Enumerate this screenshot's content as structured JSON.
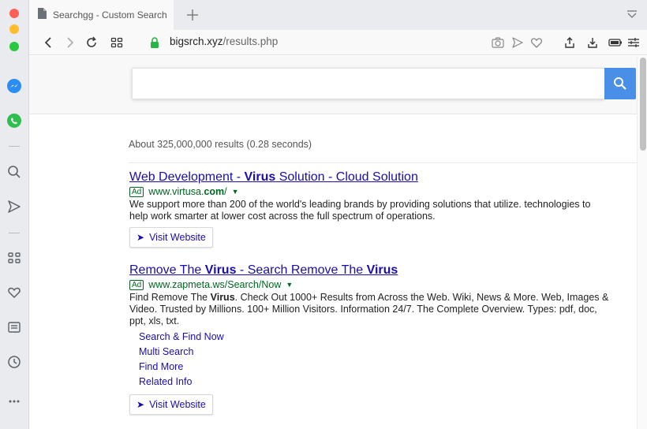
{
  "tab": {
    "title": "Searchgg - Custom Search"
  },
  "address": {
    "host": "bigsrch.xyz",
    "path": "/results.php"
  },
  "stats": "About 325,000,000 results (0.28 seconds)",
  "results": [
    {
      "title_pre": "Web Development - ",
      "title_bold": "Virus",
      "title_post": " Solution - Cloud Solution",
      "ad_label": "Ad",
      "url_pre": "www.virtusa.",
      "url_bold": "com",
      "url_post": "/",
      "desc": "We support more than 200 of the world's leading brands by providing solutions that utilize. technologies to help work smarter at lower cost across the full spectrum of operations.",
      "visit_label": "Visit Website"
    },
    {
      "title_pre": "Remove The ",
      "title_bold": "Virus",
      "title_mid": " - Search Remove The ",
      "title_bold2": "Virus",
      "ad_label": "Ad",
      "url": "www.zapmeta.ws/Search/Now",
      "desc_pre": "Find Remove The ",
      "desc_bold": "Virus",
      "desc_post": ". Check Out 1000+ Results from Across the Web. Wiki, News & More. Web, Images & Video. Trusted by Millions. 100+ Million Visitors. Information 24/7. The Complete Overview. Types: pdf, doc, ppt, xls, txt.",
      "sitelinks": [
        "Search & Find Now",
        "Multi Search",
        "Find More",
        "Related Info"
      ],
      "visit_label": "Visit Website"
    }
  ],
  "colors": {
    "link": "#1a0dab",
    "url_green": "#006621",
    "search_button": "#4a8fe7",
    "traffic_red": "#fe5f57",
    "traffic_yellow": "#febc2e",
    "traffic_green": "#28c840"
  },
  "icons": {
    "sidebar": [
      "messenger-icon",
      "whatsapp-icon",
      "search-icon",
      "send-icon",
      "grid-icon",
      "heart-icon",
      "notes-icon",
      "history-icon",
      "more-icon"
    ],
    "toolbar": [
      "back-icon",
      "forward-icon",
      "reload-icon",
      "speed-dial-icon",
      "lock-icon",
      "camera-icon",
      "send-icon",
      "heart-icon",
      "share-icon",
      "download-icon",
      "battery-icon",
      "settings-icon"
    ]
  }
}
